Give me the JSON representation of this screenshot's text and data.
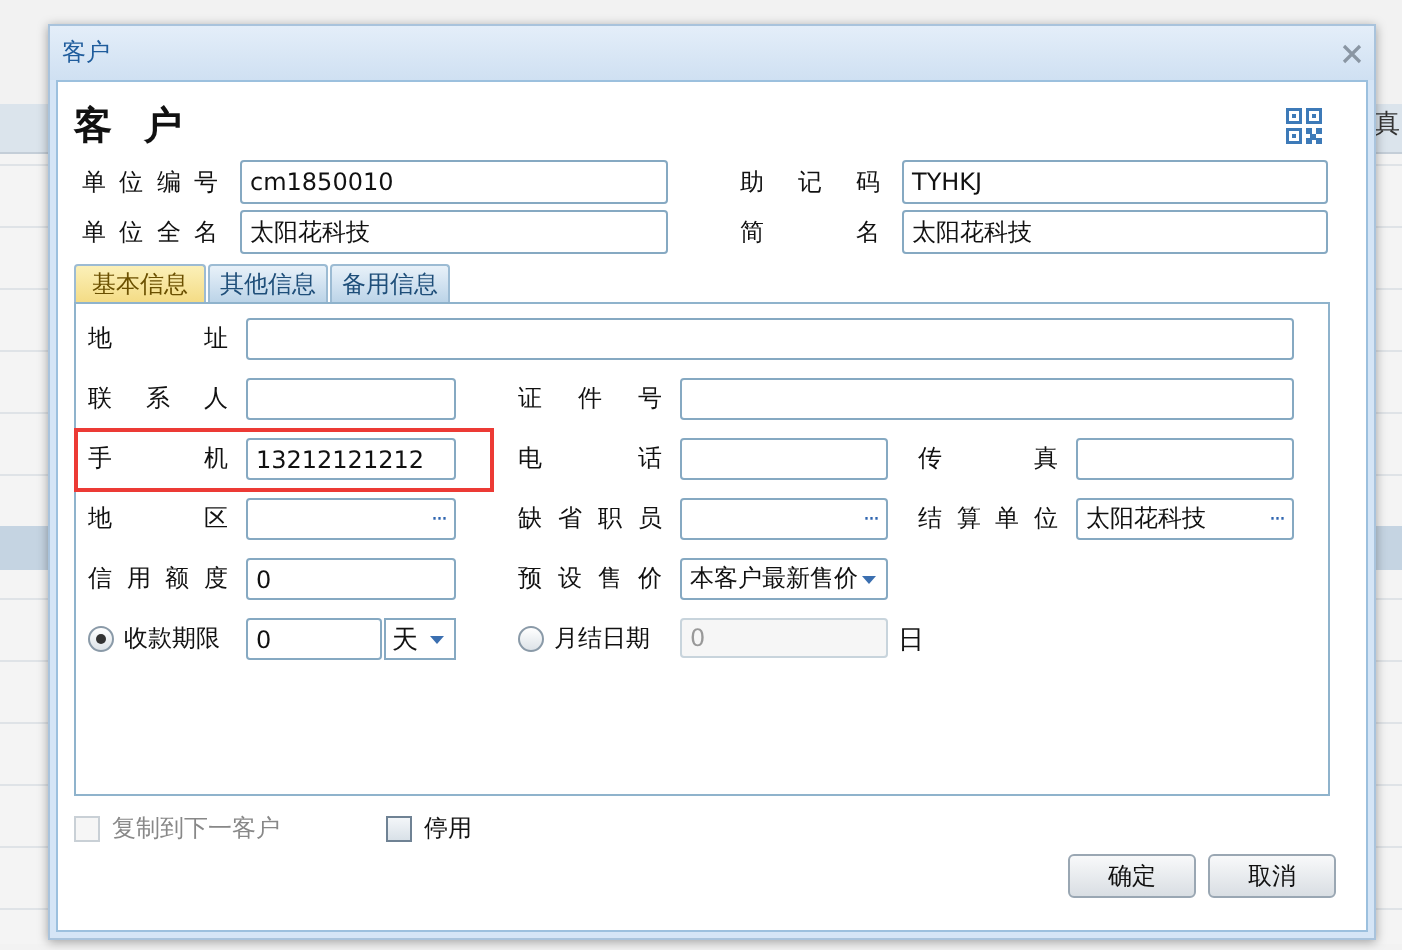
{
  "background": {
    "column_edge": "真"
  },
  "window": {
    "title": "客户",
    "heading": "客户"
  },
  "header_fields": [
    {
      "label": "单位编号",
      "value": "cm1850010"
    },
    {
      "label": "助记码",
      "value": "TYHKJ"
    },
    {
      "label": "单位全名",
      "value": "太阳花科技"
    },
    {
      "label": "简名",
      "value": "太阳花科技"
    }
  ],
  "tabs": [
    {
      "label": "基本信息",
      "selected": true
    },
    {
      "label": "其他信息",
      "selected": false
    },
    {
      "label": "备用信息",
      "selected": false
    }
  ],
  "form_rows": [
    [
      {
        "kind": "text",
        "label": "地址",
        "highlighted": false
      }
    ],
    [
      {
        "kind": "text",
        "label": "联系人",
        "highlighted": false
      },
      {
        "kind": "text",
        "label": "证件号",
        "highlighted": false
      }
    ],
    [
      {
        "kind": "text",
        "label": "手机",
        "value": "13212121212",
        "highlighted": true
      },
      {
        "kind": "text",
        "label": "电话",
        "highlighted": false
      },
      {
        "kind": "text",
        "label": "传真",
        "highlighted": false
      }
    ],
    [
      {
        "kind": "lookup",
        "label": "地区",
        "button": "···",
        "highlighted": false
      },
      {
        "kind": "lookup",
        "label": "缺省职员",
        "button": "···",
        "highlighted": false
      },
      {
        "kind": "lookup",
        "label": "结算单位",
        "value": "太阳花科技",
        "button": "···",
        "highlighted": false
      }
    ],
    [
      {
        "kind": "text",
        "label": "信用额度",
        "value": "0",
        "highlighted": false
      },
      {
        "kind": "select",
        "label": "预设售价",
        "value": "本客户最新售价",
        "highlighted": false
      }
    ]
  ],
  "payment_options": [
    {
      "kind": "term",
      "label": "收款期限",
      "selected": true,
      "value": "0",
      "unit": "天",
      "disabled": false
    },
    {
      "kind": "day",
      "label": "月结日期",
      "selected": false,
      "value": "0",
      "suffix": "日",
      "disabled": true
    }
  ],
  "checkboxes": [
    {
      "label": "复制到下一客户",
      "checked": false,
      "disabled": true
    },
    {
      "label": "停用",
      "checked": false,
      "disabled": false
    }
  ],
  "buttons": [
    "确定",
    "取消"
  ]
}
